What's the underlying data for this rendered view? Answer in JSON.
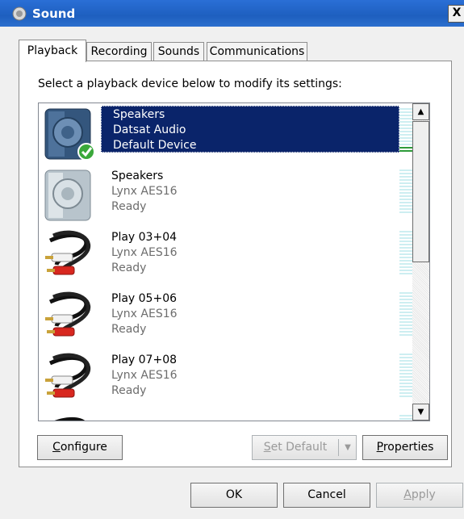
{
  "window": {
    "title": "Sound",
    "close_label": "X"
  },
  "tabs": [
    {
      "label": "Playback",
      "active": true
    },
    {
      "label": "Recording",
      "active": false
    },
    {
      "label": "Sounds",
      "active": false
    },
    {
      "label": "Communications",
      "active": false
    }
  ],
  "instruction": "Select a playback device below to modify its settings:",
  "devices": [
    {
      "name": "Speakers",
      "driver": "Datsat Audio",
      "status": "Default Device",
      "icon": "speaker-icon",
      "selected": true,
      "default": true,
      "level": 0.15
    },
    {
      "name": "Speakers",
      "driver": "Lynx AES16",
      "status": "Ready",
      "icon": "speaker-icon",
      "selected": false,
      "level": 0
    },
    {
      "name": "Play 03+04",
      "driver": "Lynx AES16",
      "status": "Ready",
      "icon": "rca-cable-icon",
      "selected": false,
      "level": 0
    },
    {
      "name": "Play 05+06",
      "driver": "Lynx AES16",
      "status": "Ready",
      "icon": "rca-cable-icon",
      "selected": false,
      "level": 0
    },
    {
      "name": "Play 07+08",
      "driver": "Lynx AES16",
      "status": "Ready",
      "icon": "rca-cable-icon",
      "selected": false,
      "level": 0
    }
  ],
  "buttons": {
    "configure": {
      "prefix": "",
      "key": "C",
      "rest": "onfigure"
    },
    "set_default": {
      "prefix": "",
      "key": "S",
      "rest": "et Default"
    },
    "properties": {
      "prefix": "",
      "key": "P",
      "rest": "roperties"
    },
    "ok": "OK",
    "cancel": "Cancel",
    "apply": {
      "prefix": "",
      "key": "A",
      "rest": "pply"
    }
  },
  "colors": {
    "selection": "#0a246a",
    "meter_empty": "#cdeef1",
    "meter_level": "#2e9b3a",
    "default_check": "#3aa83a"
  }
}
